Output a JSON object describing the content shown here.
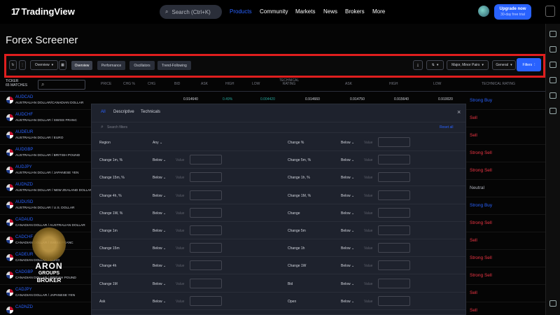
{
  "topbar": {
    "brand": "TradingView",
    "search_placeholder": "Search (Ctrl+K)",
    "nav": [
      "Products",
      "Community",
      "Markets",
      "News",
      "Brokers",
      "More"
    ],
    "upgrade_label": "Upgrade now",
    "trial_label": "30-day free trial"
  },
  "page_title": "Forex Screener",
  "toolbar": {
    "screen_name": "Overview",
    "tabs": [
      "Overview",
      "Performance",
      "Oscillators",
      "Trend-Following"
    ],
    "market_filter": "Major, Minor Pairs",
    "column_set": "General",
    "filters_label": "Filters"
  },
  "table": {
    "ticker_header": "TICKER",
    "matches": "65 MATCHES",
    "left_headers": [
      "PRICE",
      "CHG %",
      "CHG",
      "BID",
      "ASK",
      "HIGH",
      "LOW",
      "TECHNICAL RATING"
    ],
    "right_headers": [
      "ASK",
      "HIGH",
      "LOW",
      "TECHNICAL RATING"
    ],
    "rows": [
      {
        "symbol": "AUDCAD",
        "description": "AUSTRALIAN DOLLAR/CANADIAN DOLLAR",
        "bid": "0.914640",
        "chg_pct": "0.49%",
        "chg": "0.004420",
        "ask": "0.914660",
        "high": "0.914750",
        "low": "0.915640",
        "low2": "0.910020",
        "rating": "Strong Buy",
        "tone": "buy"
      },
      {
        "symbol": "AUDCHF",
        "description": "AUSTRALIAN DOLLAR / SWISS FRANC",
        "rating": "Sell",
        "tone": "sell"
      },
      {
        "symbol": "AUDEUR",
        "description": "AUSTRALIAN DOLLAR / EURO",
        "rating": "Sell",
        "tone": "sell"
      },
      {
        "symbol": "AUDGBP",
        "description": "AUSTRALIAN DOLLAR / BRITISH POUND",
        "rating": "Strong Sell",
        "tone": "sell"
      },
      {
        "symbol": "AUDJPY",
        "description": "AUSTRALIAN DOLLAR / JAPANESE YEN",
        "rating": "Strong Sell",
        "tone": "sell"
      },
      {
        "symbol": "AUDNZD",
        "description": "AUSTRALIAN DOLLAR / NEW ZEALAND DOLLAR",
        "rating": "Neutral",
        "tone": "neutral"
      },
      {
        "symbol": "AUDUSD",
        "description": "AUSTRALIAN DOLLAR / U.S. DOLLAR",
        "rating": "Strong Buy",
        "tone": "buy"
      },
      {
        "symbol": "CADAUD",
        "description": "CANADIAN DOLLAR / AUSTRALIAN DOLLAR",
        "rating": "Strong Sell",
        "tone": "sell"
      },
      {
        "symbol": "CADCHF",
        "description": "CANADIAN DOLLAR / SWISS FRANC",
        "rating": "Sell",
        "tone": "sell"
      },
      {
        "symbol": "CADEUR",
        "description": "CANADIAN DOLLAR / EURO",
        "rating": "Strong Sell",
        "tone": "sell"
      },
      {
        "symbol": "CADGBP",
        "description": "CANADIAN DOLLAR / BRITISH POUND",
        "rating": "Strong Sell",
        "tone": "sell"
      },
      {
        "symbol": "CADJPY",
        "description": "CANADIAN DOLLAR / JAPANESE YEN",
        "rating": "Sell",
        "tone": "sell"
      },
      {
        "symbol": "CADNZD",
        "description": "",
        "rating": "Sell",
        "tone": "sell"
      }
    ]
  },
  "modal": {
    "tabs": [
      "All",
      "Descriptive",
      "Technicals"
    ],
    "close": "×",
    "search_placeholder": "Search filters",
    "reset_label": "Reset all",
    "left": [
      {
        "label": "Region",
        "dropdown": "Any",
        "has_value": false
      },
      {
        "label": "Change 1m, %",
        "dropdown": "Below",
        "value": "Value",
        "has_value": true
      },
      {
        "label": "Change 15m, %",
        "dropdown": "Below",
        "value": "Value",
        "has_value": true
      },
      {
        "label": "Change 4h, %",
        "dropdown": "Below",
        "value": "Value",
        "has_value": true
      },
      {
        "label": "Change 1W, %",
        "dropdown": "Below",
        "value": "Value",
        "has_value": true
      },
      {
        "label": "Change 1m",
        "dropdown": "Below",
        "value": "Value",
        "has_value": true
      },
      {
        "label": "Change 15m",
        "dropdown": "Below",
        "value": "Value",
        "has_value": true
      },
      {
        "label": "Change 4h",
        "dropdown": "Below",
        "value": "Value",
        "has_value": true
      },
      {
        "label": "Change 1M",
        "dropdown": "Below",
        "value": "Value",
        "has_value": true
      },
      {
        "label": "Ask",
        "dropdown": "Below",
        "value": "Value",
        "has_value": true
      }
    ],
    "right": [
      {
        "label": "Change %",
        "dropdown": "Below",
        "value": "Value"
      },
      {
        "label": "Change 5m, %",
        "dropdown": "Below",
        "value": "Value"
      },
      {
        "label": "Change 1h, %",
        "dropdown": "Below",
        "value": "Value"
      },
      {
        "label": "Change 1M, %",
        "dropdown": "Below",
        "value": "Value"
      },
      {
        "label": "Change",
        "dropdown": "Below",
        "value": "Value"
      },
      {
        "label": "Change 5m",
        "dropdown": "Below",
        "value": "Value"
      },
      {
        "label": "Change 1h",
        "dropdown": "Below",
        "value": "Value"
      },
      {
        "label": "Change 1W",
        "dropdown": "Below",
        "value": "Value"
      },
      {
        "label": "Bid",
        "dropdown": "Below",
        "value": "Value"
      },
      {
        "label": "Open",
        "dropdown": "Below",
        "value": "Value"
      }
    ]
  },
  "watermark": {
    "line1": "ARON",
    "line2": "GROUPS",
    "line3": "BROKER"
  },
  "colors": {
    "accent": "#2962ff",
    "sell": "#f23645",
    "buy": "#2962ff",
    "highlight_border": "#e01e1e",
    "positive": "#26a69a"
  }
}
